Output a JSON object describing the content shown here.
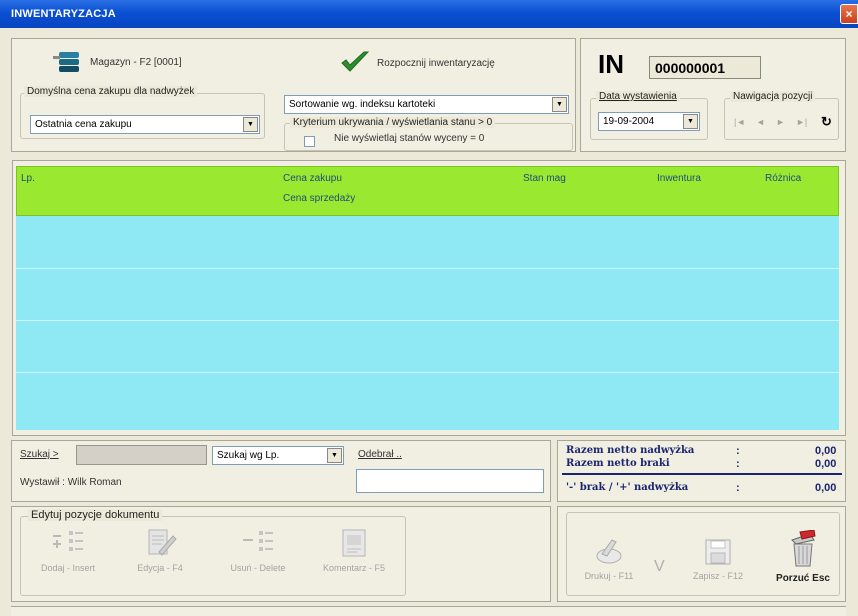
{
  "window": {
    "title": "INWENTARYZACJA",
    "close": "×"
  },
  "header": {
    "warehouse": "Magazyn - F2 [0001]",
    "start_label": "Rozpocznij inwentaryzację",
    "doc_type": "IN",
    "doc_number": "000000001"
  },
  "surplus_price": {
    "group_label": "Domyślna cena zakupu dla nadwyżek",
    "value": "Ostatnia cena zakupu"
  },
  "sorting": {
    "value": "Sortowanie wg. indeksu kartoteki"
  },
  "criterion": {
    "group_label": "Kryterium ukrywania / wyświetlania stanu > 0",
    "checkbox_label": "Nie wyświetlaj stanów wyceny = 0"
  },
  "issue_date": {
    "group_label": "Data wystawienia",
    "value": "19-09-2004"
  },
  "position_nav": {
    "group_label": "Nawigacja pozycji",
    "refresh_glyph": "↻"
  },
  "grid": {
    "columns": {
      "lp": "Lp.",
      "price_purchase": "Cena zakupu",
      "price_sale": "Cena sprzedaży",
      "stock": "Stan mag",
      "inventory": "Inwentura",
      "difference": "Różnica"
    }
  },
  "search": {
    "label": "Szukaj >",
    "value": "",
    "mode": "Szukaj wg Lp.",
    "received_label": "Odebrał ..",
    "received_value": ""
  },
  "issued_by": "Wystawił : Wilk Roman",
  "totals": {
    "surplus_label": "Razem netto nadwyżka",
    "surplus_value": "0,00",
    "shortage_label": "Razem netto braki",
    "shortage_value": "0,00",
    "balance_label": "'-' brak / '+' nadwyżka",
    "balance_value": "0,00",
    "colon": ":"
  },
  "edit_group": {
    "label": "Edytuj pozycje dokumentu",
    "add": "Dodaj - Insert",
    "edit": "Edycja - F4",
    "delete": "Usuń - Delete",
    "comment": "Komentarz - F5"
  },
  "actions": {
    "print": "Drukuj - F11",
    "v_glyph": "V",
    "save": "Zapisz - F12",
    "abandon": "Porzuć Esc"
  },
  "colors": {
    "grid_header": "#9be830",
    "grid_body": "#8ee9f5",
    "title_bar": "#0a4fd2",
    "check": "#2b8f2b"
  }
}
